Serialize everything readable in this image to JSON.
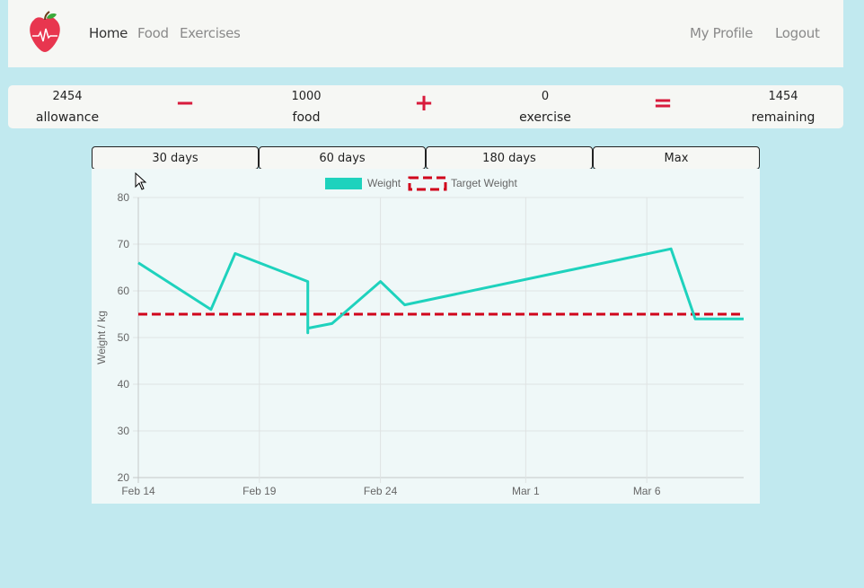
{
  "nav": {
    "links": [
      "Home",
      "Food",
      "Exercises"
    ],
    "profile": "My Profile",
    "logout": "Logout"
  },
  "summary": {
    "allowance": {
      "value": "2454",
      "label": "allowance"
    },
    "food": {
      "value": "1000",
      "label": "food"
    },
    "exercise": {
      "value": "0",
      "label": "exercise"
    },
    "remaining": {
      "value": "1454",
      "label": "remaining"
    },
    "ops": [
      "−",
      "+",
      "="
    ]
  },
  "ranges": [
    "30 days",
    "60 days",
    "180 days",
    "Max"
  ],
  "colors": {
    "weight": "#1ed2bd",
    "target": "#d0021b",
    "accent": "#d81b3c",
    "background": "#c1e9ef"
  },
  "chart_data": {
    "type": "line",
    "x_axis": {
      "type": "time",
      "ticks": [
        "Feb 14",
        "Feb 19",
        "Feb 24",
        "Mar 1",
        "Mar 6"
      ],
      "range": [
        "Feb 14",
        "Mar 10"
      ]
    },
    "ylabel": "Weight / kg",
    "ylim": [
      20,
      80
    ],
    "yticks": [
      80,
      70,
      60,
      50,
      40,
      30,
      20
    ],
    "grid": true,
    "legend_position": "top",
    "series": [
      {
        "name": "Weight",
        "points": [
          {
            "x": "Feb 14",
            "y": 66
          },
          {
            "x": "Feb 17",
            "y": 56
          },
          {
            "x": "Feb 18",
            "y": 68
          },
          {
            "x": "Feb 21",
            "y": 62
          },
          {
            "x": "Feb 21",
            "y": 51
          },
          {
            "x": "Feb 21",
            "y": 52
          },
          {
            "x": "Feb 22",
            "y": 53
          },
          {
            "x": "Feb 24",
            "y": 62
          },
          {
            "x": "Feb 25",
            "y": 57
          },
          {
            "x": "Mar 7",
            "y": 69
          },
          {
            "x": "Mar 8",
            "y": 54
          },
          {
            "x": "Mar 10",
            "y": 54
          }
        ]
      },
      {
        "name": "Target Weight",
        "points": [
          {
            "x": "Feb 14",
            "y": 55
          },
          {
            "x": "Mar 10",
            "y": 55
          }
        ]
      }
    ]
  }
}
